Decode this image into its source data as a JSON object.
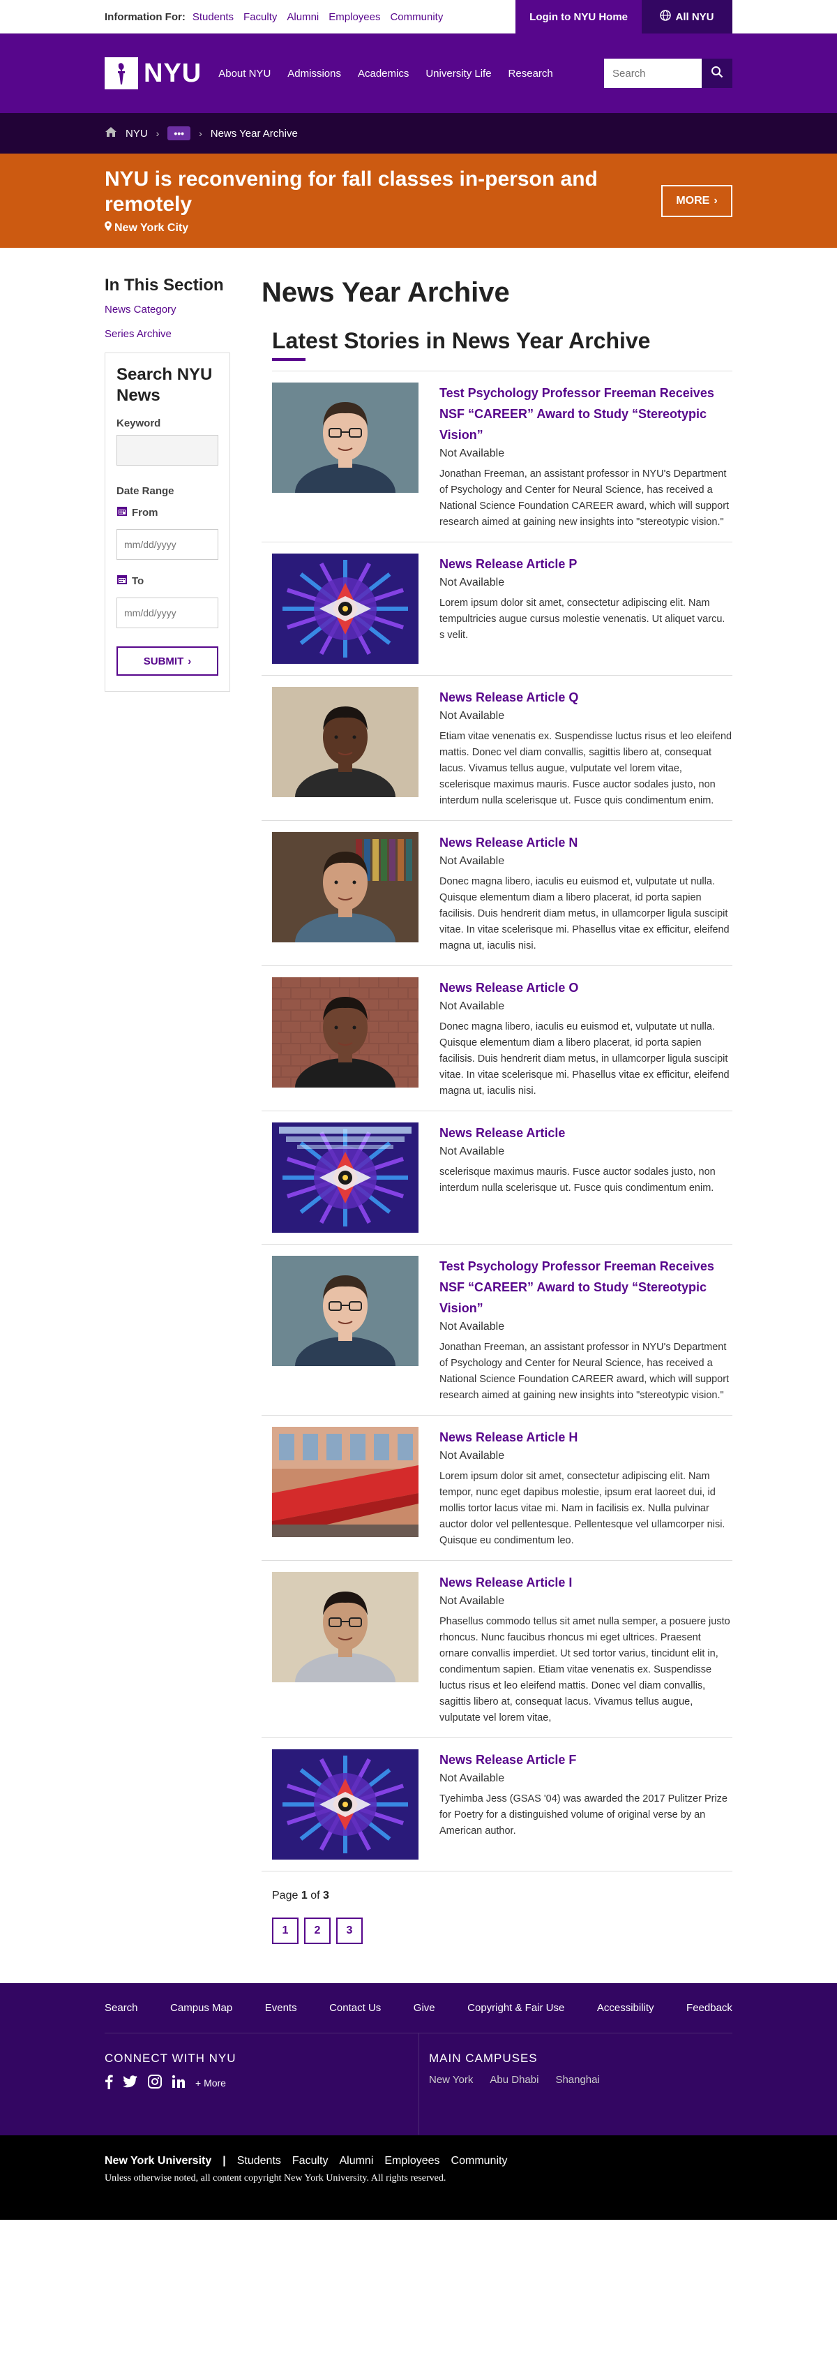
{
  "topbar": {
    "info_label": "Information For:",
    "audiences": [
      "Students",
      "Faculty",
      "Alumni",
      "Employees",
      "Community"
    ],
    "login": "Login to NYU Home",
    "all_nyu": "All NYU"
  },
  "header": {
    "logo_text": "NYU",
    "nav": [
      "About NYU",
      "Admissions",
      "Academics",
      "University Life",
      "Research"
    ],
    "search_placeholder": "Search"
  },
  "breadcrumb": {
    "home": "NYU",
    "ellipsis": "•••",
    "current": "News Year Archive"
  },
  "alert": {
    "title": "NYU is reconvening for fall classes in-person and remotely",
    "location": "New York City",
    "more": "MORE"
  },
  "sidebar": {
    "title": "In This Section",
    "links": [
      "News Category",
      "Series Archive"
    ],
    "search": {
      "title": "Search NYU News",
      "keyword_label": "Keyword",
      "date_range_label": "Date Range",
      "from_label": "From",
      "to_label": "To",
      "date_placeholder": "mm/dd/yyyy",
      "submit": "SUBMIT"
    }
  },
  "main": {
    "page_title": "News Year Archive",
    "section_title": "Latest Stories in News Year Archive",
    "stories": [
      {
        "title": "Test Psychology Professor Freeman Receives NSF “CAREER” Award to Study “Stereotypic Vision”",
        "status": "Not Available",
        "text": "Jonathan Freeman, an assistant professor in NYU's Department of Psychology and Center for Neural Science, has received a National Science Foundation CAREER award, which will support research aimed at gaining new insights into \"stereotypic vision.\"",
        "image": "portrait-man-glasses"
      },
      {
        "title": "News Release Article P",
        "status": "Not Available",
        "text": "Lorem ipsum dolor sit amet, consectetur adipiscing elit. Nam tempultricies augue cursus molestie venenatis. Ut aliquet varcu. s velit.",
        "image": "kaleidoscope"
      },
      {
        "title": "News Release Article Q",
        "status": "Not Available",
        "text": "Etiam vitae venenatis ex. Suspendisse luctus risus et leo eleifend mattis. Donec vel diam convallis, sagittis libero at, consequat lacus. Vivamus tellus augue, vulputate vel lorem vitae, scelerisque maximus mauris. Fusce auctor sodales justo, non interdum nulla scelerisque ut. Fusce quis condimentum enim.",
        "image": "portrait-woman"
      },
      {
        "title": "News Release Article N",
        "status": "Not Available",
        "text": "Donec magna libero, iaculis eu euismod et, vulputate ut nulla. Quisque elementum diam a libero placerat, id porta sapien facilisis. Duis hendrerit diam metus, in ullamcorper ligula suscipit vitae. In vitae scelerisque mi. Phasellus vitae ex efficitur, eleifend magna ut, iaculis nisi.",
        "image": "portrait-man-books"
      },
      {
        "title": "News Release Article O",
        "status": "Not Available",
        "text": "Donec magna libero, iaculis eu euismod et, vulputate ut nulla. Quisque elementum diam a libero placerat, id porta sapien facilisis. Duis hendrerit diam metus, in ullamcorper ligula suscipit vitae. In vitae scelerisque mi. Phasellus vitae ex efficitur, eleifend magna ut, iaculis nisi.",
        "image": "portrait-woman-brick"
      },
      {
        "title": "News Release Article",
        "status": "Not Available",
        "text": "scelerisque maximus mauris. Fusce auctor sodales justo, non interdum nulla scelerisque ut. Fusce quis condimentum enim.",
        "image": "kaleidoscope-text"
      },
      {
        "title": "Test Psychology Professor Freeman Receives NSF “CAREER” Award to Study “Stereotypic Vision”",
        "status": "Not Available",
        "text": "Jonathan Freeman, an assistant professor in NYU's Department of Psychology and Center for Neural Science, has received a National Science Foundation CAREER award, which will support research aimed at gaining new insights into \"stereotypic vision.\"",
        "image": "portrait-man-glasses"
      },
      {
        "title": "News Release Article H",
        "status": "Not Available",
        "text": "Lorem ipsum dolor sit amet, consectetur adipiscing elit. Nam tempor, nunc eget dapibus molestie, ipsum erat laoreet dui, id mollis tortor lacus vitae mi. Nam in facilisis ex. Nulla pulvinar auctor dolor vel pellentesque. Pellentesque vel ullamcorper nisi. Quisque eu condimentum leo.",
        "image": "emergency-sign"
      },
      {
        "title": "News Release Article I",
        "status": "Not Available",
        "text": "Phasellus commodo tellus sit amet nulla semper, a posuere justo rhoncus. Nunc faucibus rhoncus mi eget ultrices. Praesent ornare convallis imperdiet. Ut sed tortor varius, tincidunt elit in, condimentum sapien. Etiam vitae venenatis ex. Suspendisse luctus risus et leo eleifend mattis. Donec vel diam convallis, sagittis libero at, consequat lacus. Vivamus tellus augue, vulputate vel lorem vitae,",
        "image": "portrait-man-smile"
      },
      {
        "title": "News Release Article F",
        "status": "Not Available",
        "text": "Tyehimba Jess (GSAS '04) was awarded the 2017 Pulitzer Prize for Poetry for a distinguished volume of original verse by an American author.",
        "image": "kaleidoscope"
      }
    ],
    "pager": {
      "prefix": "Page",
      "current": "1",
      "of": "of",
      "total": "3",
      "pages": [
        "1",
        "2",
        "3"
      ]
    }
  },
  "footer": {
    "links": [
      "Search",
      "Campus Map",
      "Events",
      "Contact Us",
      "Give",
      "Copyright & Fair Use",
      "Accessibility",
      "Feedback"
    ],
    "connect_title": "CONNECT WITH NYU",
    "more": "+ More",
    "campuses_title": "MAIN CAMPUSES",
    "campuses": [
      "New York",
      "Abu Dhabi",
      "Shanghai"
    ],
    "brand": "New York University",
    "separator": "|",
    "audiences": [
      "Students",
      "Faculty",
      "Alumni",
      "Employees",
      "Community"
    ],
    "copyright": "Unless otherwise noted, all content copyright New York University. All rights reserved."
  },
  "colors": {
    "brand": "#57068c",
    "dark_brand": "#330662",
    "alert": "#cc5a11"
  }
}
